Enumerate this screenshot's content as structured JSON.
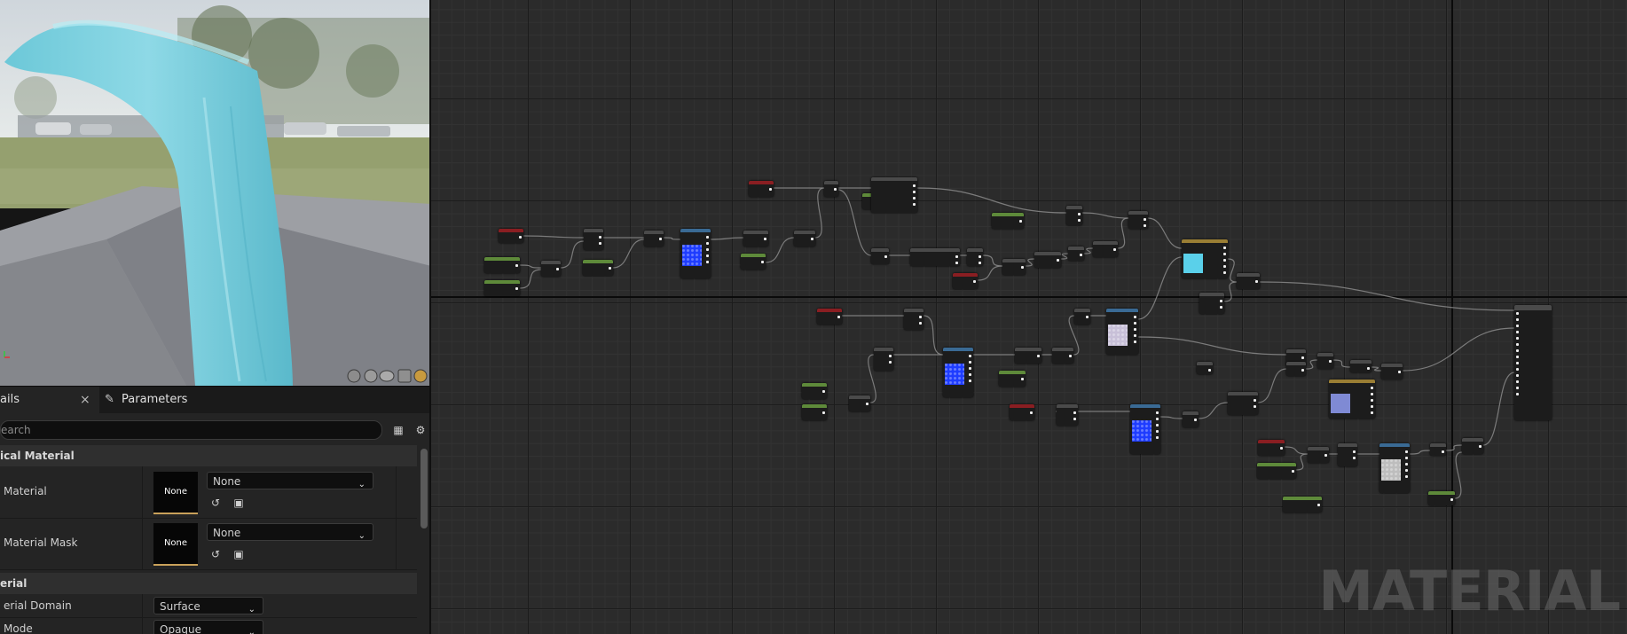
{
  "details": {
    "tabs": [
      {
        "label": "ails",
        "close": "×"
      },
      {
        "label": "Parameters"
      }
    ],
    "search_placeholder": "earch",
    "sections": [
      {
        "title": "ical Material"
      },
      {
        "title": "erial"
      }
    ],
    "properties": [
      {
        "label": "Material",
        "thumb": "None",
        "value": "None"
      },
      {
        "label": "Material Mask",
        "thumb": "None",
        "value": "None"
      },
      {
        "label": "erial Domain",
        "value": "Surface"
      },
      {
        "label": "Mode",
        "value": "Opaque"
      }
    ]
  },
  "graph": {
    "watermark": "MATERIAL"
  },
  "colors": {
    "node_green": "#5e8a3a",
    "node_red": "#8a1e22",
    "node_blue": "#3a6a94",
    "node_gold": "#9a7e34",
    "node_gray": "#4a4a4a",
    "texture_blue": "#1e3cff",
    "param_cyan": "#5ad0ea",
    "param_violet": "#7f8ad4"
  },
  "icons": [
    "gizmo-axis-icon",
    "viewport-shape-icons",
    "table-view-icon",
    "settings-gear-icon",
    "reset-arrow-icon",
    "browse-folder-icon",
    "chevron-down-icon",
    "parameters-tab-icon",
    "close-icon"
  ]
}
